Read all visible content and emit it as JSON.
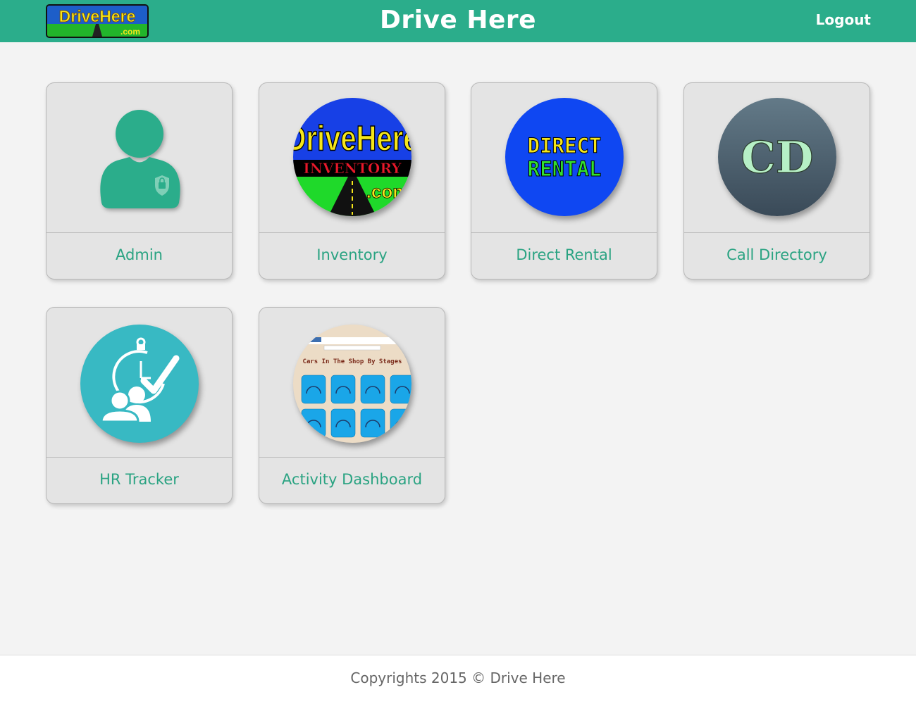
{
  "header": {
    "title": "Drive Here",
    "logout_label": "Logout",
    "logo_text": "DriveHere",
    "logo_sub": ".com",
    "background": "#2bad8b"
  },
  "tiles": [
    {
      "label": "Admin",
      "icon": "admin-user-icon"
    },
    {
      "label": "Inventory",
      "icon": "inventory-logo-icon",
      "logo_line1": "DriveHere",
      "logo_line2": "INVENTORY",
      "logo_line3": ".com"
    },
    {
      "label": "Direct Rental",
      "icon": "direct-rental-icon",
      "line1": "DIRECT",
      "line2": "RENTAL"
    },
    {
      "label": "Call Directory",
      "icon": "call-directory-icon",
      "initials": "CD"
    },
    {
      "label": "HR Tracker",
      "icon": "hr-tracker-icon"
    },
    {
      "label": "Activity Dashboard",
      "icon": "activity-dashboard-icon",
      "caption": "Cars In The Shop By Stages"
    }
  ],
  "footer": {
    "copyright": "Copyrights 2015 © Drive Here"
  },
  "colors": {
    "accent": "#2bad8b",
    "tile_text": "#2aa382",
    "tile_bg": "#e4e4e4"
  }
}
